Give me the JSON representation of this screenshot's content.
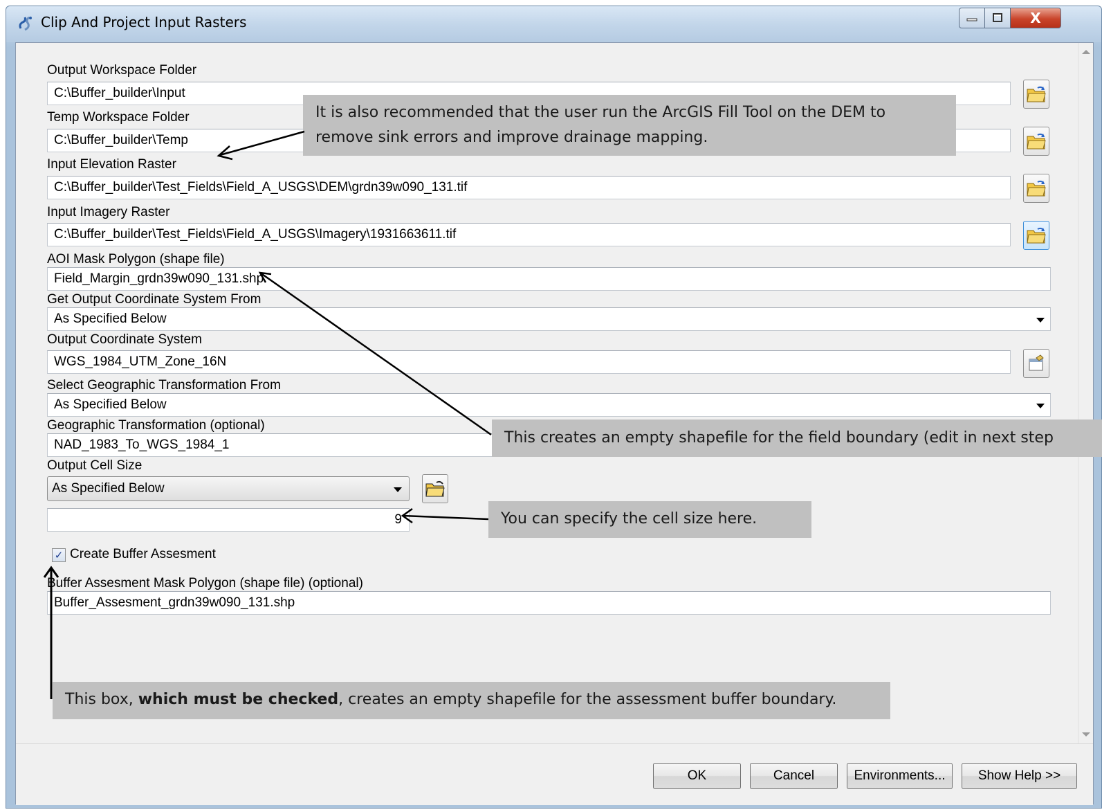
{
  "window": {
    "title": "Clip And Project Input Rasters",
    "close_label": "X"
  },
  "form": {
    "output_workspace": {
      "label": "Output Workspace Folder",
      "value": "C:\\Buffer_builder\\Input"
    },
    "temp_workspace": {
      "label": "Temp Workspace Folder",
      "value": "C:\\Buffer_builder\\Temp"
    },
    "input_elevation": {
      "label": "Input Elevation Raster",
      "value": "C:\\Buffer_builder\\Test_Fields\\Field_A_USGS\\DEM\\grdn39w090_131.tif"
    },
    "input_imagery": {
      "label": "Input Imagery Raster",
      "value": "C:\\Buffer_builder\\Test_Fields\\Field_A_USGS\\Imagery\\1931663611.tif"
    },
    "aoi_mask": {
      "label": "AOI Mask Polygon (shape file)",
      "value": "Field_Margin_grdn39w090_131.shp"
    },
    "coord_from": {
      "label": "Get Output Coordinate System From",
      "value": "As Specified Below"
    },
    "coord_system": {
      "label": "Output Coordinate System",
      "value": "WGS_1984_UTM_Zone_16N"
    },
    "geo_transform_from": {
      "label": "Select Geographic Transformation From",
      "value": "As Specified Below"
    },
    "geo_transform": {
      "label": "Geographic Transformation (optional)",
      "value": "NAD_1983_To_WGS_1984_1"
    },
    "cell_size": {
      "label": "Output Cell Size",
      "mode": "As Specified Below",
      "value": "9"
    },
    "create_buffer": {
      "label": "Create Buffer Assesment",
      "checked": true
    },
    "buffer_mask": {
      "label": "Buffer Assesment Mask Polygon (shape file) (optional)",
      "value": "Buffer_Assesment_grdn39w090_131.shp"
    }
  },
  "footer": {
    "ok": "OK",
    "cancel": "Cancel",
    "environments": "Environments...",
    "show_help": "Show Help >>"
  },
  "annotations": {
    "fill_tool_line1": "It is also recommended that the user run the ArcGIS Fill Tool on the DEM to",
    "fill_tool_line2": "remove sink errors and improve drainage mapping.",
    "field_boundary": "This creates an empty shapefile for the field boundary (edit in next step",
    "cell_size": "You can specify the cell size here.",
    "checkbox_pre": "This box, ",
    "checkbox_bold": "which must be checked",
    "checkbox_post": ", creates an empty shapefile for the assessment buffer boundary."
  },
  "colors": {
    "annotation_bg": "#c0c0c0",
    "close_button": "#c9442a",
    "dialog_bg": "#f0f0f0"
  }
}
